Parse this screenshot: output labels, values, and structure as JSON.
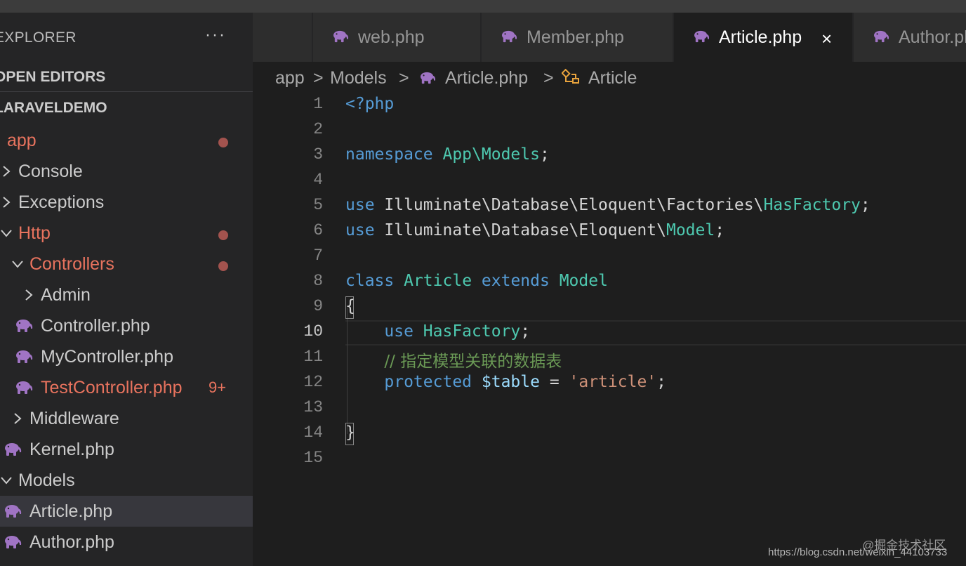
{
  "sidebar": {
    "title": "EXPLORER",
    "more": "···",
    "open_editors": "OPEN EDITORS",
    "project": "LARAVELDEMO",
    "tree": [
      {
        "label": "app",
        "indent": 0,
        "chevron": "none",
        "modified": true,
        "dot": true,
        "icon": "none"
      },
      {
        "label": "Console",
        "indent": 1,
        "chevron": "right",
        "modified": false,
        "dot": false,
        "icon": "none"
      },
      {
        "label": "Exceptions",
        "indent": 1,
        "chevron": "right",
        "modified": false,
        "dot": false,
        "icon": "none"
      },
      {
        "label": "Http",
        "indent": 1,
        "chevron": "down",
        "modified": true,
        "dot": true,
        "icon": "none"
      },
      {
        "label": "Controllers",
        "indent": 2,
        "chevron": "down",
        "modified": true,
        "dot": true,
        "icon": "none"
      },
      {
        "label": "Admin",
        "indent": 3,
        "chevron": "right",
        "modified": false,
        "dot": false,
        "icon": "none"
      },
      {
        "label": "Controller.php",
        "indent": 3,
        "chevron": "none",
        "modified": false,
        "dot": false,
        "icon": "php"
      },
      {
        "label": "MyController.php",
        "indent": 3,
        "chevron": "none",
        "modified": false,
        "dot": false,
        "icon": "php"
      },
      {
        "label": "TestController.php",
        "indent": 3,
        "chevron": "none",
        "modified": true,
        "dot": false,
        "badge": "9+",
        "icon": "php"
      },
      {
        "label": "Middleware",
        "indent": 2,
        "chevron": "right",
        "modified": false,
        "dot": false,
        "icon": "none"
      },
      {
        "label": "Kernel.php",
        "indent": 2,
        "chevron": "none",
        "modified": false,
        "dot": false,
        "icon": "php"
      },
      {
        "label": "Models",
        "indent": 1,
        "chevron": "down",
        "modified": false,
        "dot": false,
        "icon": "none"
      },
      {
        "label": "Article.php",
        "indent": 2,
        "chevron": "none",
        "modified": false,
        "dot": false,
        "icon": "php",
        "selected": true
      },
      {
        "label": "Author.php",
        "indent": 2,
        "chevron": "none",
        "modified": false,
        "dot": false,
        "icon": "php"
      }
    ]
  },
  "tabs": [
    {
      "label": "web.php",
      "active": false
    },
    {
      "label": "Member.php",
      "active": false
    },
    {
      "label": "Article.php",
      "active": true,
      "close": "×"
    },
    {
      "label": "Author.php",
      "active": false
    }
  ],
  "breadcrumb": {
    "items": [
      "app",
      "Models",
      "Article.php",
      "Article"
    ],
    "separator": ">"
  },
  "editor": {
    "current_line": 10,
    "line_numbers": [
      "1",
      "2",
      "3",
      "4",
      "5",
      "6",
      "7",
      "8",
      "9",
      "10",
      "11",
      "12",
      "13",
      "14",
      "15"
    ],
    "lines": [
      [
        {
          "t": "<?php",
          "c": "kw"
        }
      ],
      [],
      [
        {
          "t": "namespace",
          "c": "kw"
        },
        {
          "t": " "
        },
        {
          "t": "App\\Models",
          "c": "cls"
        },
        {
          "t": ";"
        }
      ],
      [],
      [
        {
          "t": "use",
          "c": "kw"
        },
        {
          "t": " Illuminate\\Database\\Eloquent\\Factories\\"
        },
        {
          "t": "HasFactory",
          "c": "cls"
        },
        {
          "t": ";"
        }
      ],
      [
        {
          "t": "use",
          "c": "kw"
        },
        {
          "t": " Illuminate\\Database\\Eloquent\\"
        },
        {
          "t": "Model",
          "c": "cls"
        },
        {
          "t": ";"
        }
      ],
      [],
      [
        {
          "t": "class",
          "c": "kw"
        },
        {
          "t": " "
        },
        {
          "t": "Article",
          "c": "cls"
        },
        {
          "t": " "
        },
        {
          "t": "extends",
          "c": "kw"
        },
        {
          "t": " "
        },
        {
          "t": "Model",
          "c": "cls"
        }
      ],
      [
        {
          "t": "{"
        }
      ],
      [
        {
          "t": "    "
        },
        {
          "t": "use",
          "c": "kw"
        },
        {
          "t": " "
        },
        {
          "t": "HasFactory",
          "c": "cls"
        },
        {
          "t": ";"
        }
      ],
      [
        {
          "t": "    "
        },
        {
          "t": "// 指定模型关联的数据表",
          "c": "cmt"
        }
      ],
      [
        {
          "t": "    "
        },
        {
          "t": "protected",
          "c": "kw"
        },
        {
          "t": " "
        },
        {
          "t": "$table",
          "c": "var"
        },
        {
          "t": " = "
        },
        {
          "t": "'article'",
          "c": "str"
        },
        {
          "t": ";"
        }
      ],
      [],
      [
        {
          "t": "}"
        }
      ],
      []
    ]
  },
  "watermark": {
    "text": "@掘金技术社区",
    "url": "https://blog.csdn.net/weixin_44103733"
  },
  "colors": {
    "modified": "#e8735e",
    "php_icon": "#a074c4",
    "keyword": "#569cd6",
    "type": "#4ec9b0",
    "string": "#ce9178",
    "comment": "#6a9955"
  }
}
